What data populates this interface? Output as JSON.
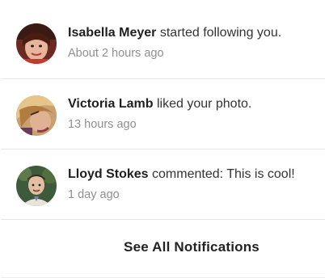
{
  "notifications": [
    {
      "name": "Isabella Meyer",
      "action": " started following you.",
      "time": "About 2 hours ago",
      "avatar_icon": "avatar-photo"
    },
    {
      "name": "Victoria Lamb",
      "action": " liked your photo.",
      "time": "13 hours ago",
      "avatar_icon": "avatar-photo"
    },
    {
      "name": "Lloyd Stokes",
      "action": " commented: This is cool!",
      "time": "1 day ago",
      "avatar_icon": "avatar-photo"
    }
  ],
  "footer": {
    "see_all_label": "See All Notifications"
  },
  "colors": {
    "divider": "#e6e6e6",
    "muted_text": "#8f8f8f"
  }
}
